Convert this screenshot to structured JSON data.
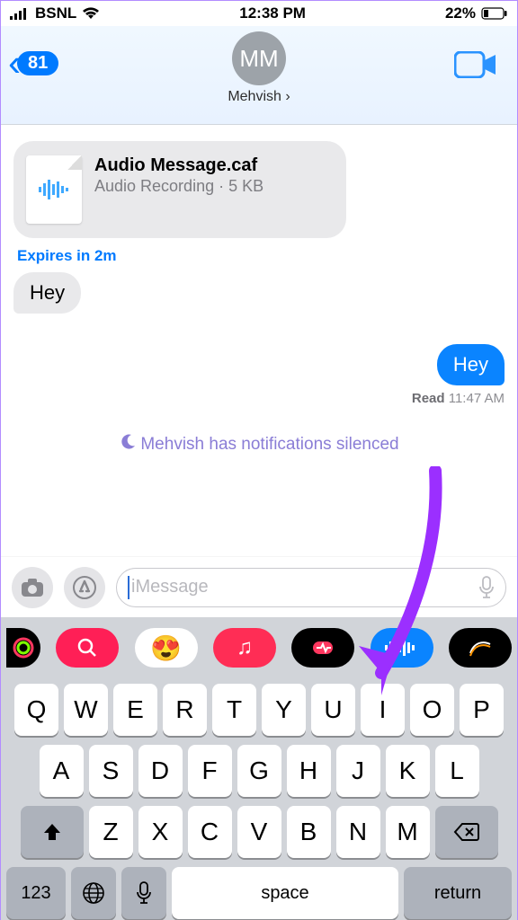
{
  "status": {
    "carrier": "BSNL",
    "time": "12:38 PM",
    "battery_pct": "22%"
  },
  "nav": {
    "back_count": "81",
    "avatar_initials": "MM",
    "contact_name": "Mehvish"
  },
  "conversation": {
    "file": {
      "title": "Audio Message.caf",
      "subtitle": "Audio Recording · 5 KB"
    },
    "expires": "Expires in 2m",
    "incoming": "Hey",
    "outgoing": "Hey",
    "read_label": "Read",
    "read_time": "11:47 AM",
    "silenced": "Mehvish has notifications silenced"
  },
  "compose": {
    "placeholder": "iMessage"
  },
  "keyboard": {
    "row1": [
      "Q",
      "W",
      "E",
      "R",
      "T",
      "Y",
      "U",
      "I",
      "O",
      "P"
    ],
    "row2": [
      "A",
      "S",
      "D",
      "F",
      "G",
      "H",
      "J",
      "K",
      "L"
    ],
    "row3": [
      "Z",
      "X",
      "C",
      "V",
      "B",
      "N",
      "M"
    ],
    "numeric_label": "123",
    "space_label": "space",
    "return_label": "return"
  },
  "app_strip": [
    {
      "name": "activity-icon",
      "bg": "#000"
    },
    {
      "name": "search-app-icon",
      "bg": "#ff1f56"
    },
    {
      "name": "memoji-icon",
      "bg": "linear-gradient(90deg,#ffcc00,#ff375f,#5856d6)"
    },
    {
      "name": "music-icon",
      "bg": "#ff2d55"
    },
    {
      "name": "fitness-icon",
      "bg": "#000"
    },
    {
      "name": "audio-wave-icon",
      "bg": "#0a84ff"
    },
    {
      "name": "digital-touch-icon",
      "bg": "#000"
    }
  ],
  "colors": {
    "accent": "#007aff",
    "bubble_out": "#0a84ff",
    "bubble_in": "#e9e9eb"
  }
}
